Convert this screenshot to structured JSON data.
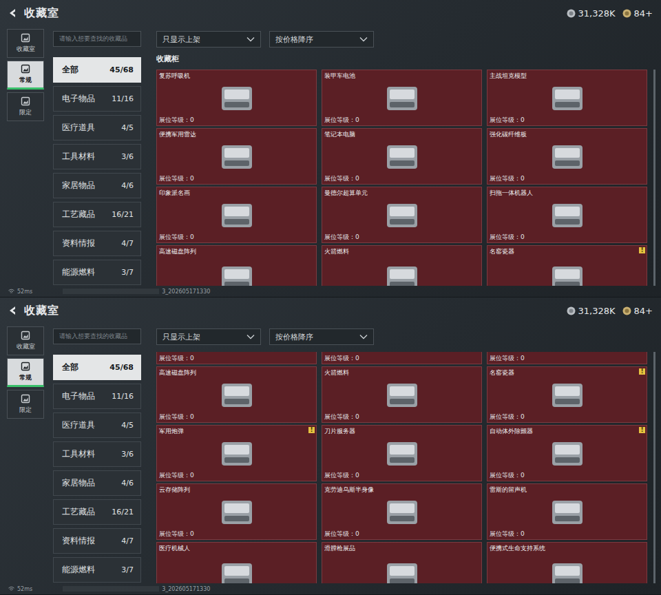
{
  "panels": [
    {
      "header": {
        "title": "收藏室",
        "currencies": [
          {
            "value": "31,328K"
          },
          {
            "value": "84+"
          }
        ]
      },
      "nav": [
        {
          "label": "收藏室",
          "selected": false
        },
        {
          "label": "常规",
          "selected": true
        },
        {
          "label": "限定",
          "selected": false
        }
      ],
      "search": {
        "placeholder": "请输入想要查找的收藏品"
      },
      "categories": [
        {
          "label": "全部",
          "count": "45/68",
          "selected": true
        },
        {
          "label": "电子物品",
          "count": "11/16",
          "selected": false
        },
        {
          "label": "医疗道具",
          "count": "4/5",
          "selected": false
        },
        {
          "label": "工具材料",
          "count": "3/6",
          "selected": false
        },
        {
          "label": "家居物品",
          "count": "4/6",
          "selected": false
        },
        {
          "label": "工艺藏品",
          "count": "16/21",
          "selected": false
        },
        {
          "label": "资料情报",
          "count": "4/7",
          "selected": false
        },
        {
          "label": "能源燃料",
          "count": "3/7",
          "selected": false
        }
      ],
      "filters": [
        "只显示上架",
        "按价格降序"
      ],
      "section_title": "收藏柜",
      "cards": [
        {
          "kind": "full",
          "name": "复苏呼吸机",
          "level": "展位等级：0",
          "badge": ""
        },
        {
          "kind": "full",
          "name": "装甲车电池",
          "level": "展位等级：0",
          "badge": ""
        },
        {
          "kind": "full",
          "name": "主战坦克模型",
          "level": "展位等级：0",
          "badge": ""
        },
        {
          "kind": "full",
          "name": "便携军用雷达",
          "level": "展位等级：0",
          "badge": ""
        },
        {
          "kind": "full",
          "name": "笔记本电脑",
          "level": "展位等级：0",
          "badge": ""
        },
        {
          "kind": "full",
          "name": "强化碳纤维板",
          "level": "展位等级：0",
          "badge": ""
        },
        {
          "kind": "full",
          "name": "印象派名画",
          "level": "展位等级：0",
          "badge": ""
        },
        {
          "kind": "full",
          "name": "曼德尔超算单元",
          "level": "展位等级：0",
          "badge": ""
        },
        {
          "kind": "full",
          "name": "扫拖一体机器人",
          "level": "展位等级：0",
          "badge": ""
        },
        {
          "kind": "top-only",
          "name": "高速磁盘阵列",
          "level": "",
          "badge": ""
        },
        {
          "kind": "top-only",
          "name": "火箭燃料",
          "level": "",
          "badge": ""
        },
        {
          "kind": "top-only",
          "name": "名窑瓷器",
          "level": "",
          "badge": "!"
        }
      ],
      "status": {
        "ping": "52ms",
        "build": "3_202605171330"
      }
    },
    {
      "header": {
        "title": "收藏室",
        "currencies": [
          {
            "value": "31,328K"
          },
          {
            "value": "84+"
          }
        ]
      },
      "nav": [
        {
          "label": "收藏室",
          "selected": false
        },
        {
          "label": "常规",
          "selected": true
        },
        {
          "label": "限定",
          "selected": false
        }
      ],
      "search": {
        "placeholder": "请输入想要查找的收藏品"
      },
      "categories": [
        {
          "label": "全部",
          "count": "45/68",
          "selected": true
        },
        {
          "label": "电子物品",
          "count": "11/16",
          "selected": false
        },
        {
          "label": "医疗道具",
          "count": "4/5",
          "selected": false
        },
        {
          "label": "工具材料",
          "count": "3/6",
          "selected": false
        },
        {
          "label": "家居物品",
          "count": "4/6",
          "selected": false
        },
        {
          "label": "工艺藏品",
          "count": "16/21",
          "selected": false
        },
        {
          "label": "资料情报",
          "count": "4/7",
          "selected": false
        },
        {
          "label": "能源燃料",
          "count": "3/7",
          "selected": false
        }
      ],
      "filters": [
        "只显示上架",
        "按价格降序"
      ],
      "cards": [
        {
          "kind": "level-only",
          "name": "",
          "level": "展位等级：0",
          "badge": ""
        },
        {
          "kind": "level-only",
          "name": "",
          "level": "展位等级：0",
          "badge": ""
        },
        {
          "kind": "level-only",
          "name": "",
          "level": "展位等级：0",
          "badge": ""
        },
        {
          "kind": "full",
          "name": "高速磁盘阵列",
          "level": "展位等级：0",
          "badge": ""
        },
        {
          "kind": "full",
          "name": "火箭燃料",
          "level": "展位等级：0",
          "badge": ""
        },
        {
          "kind": "full",
          "name": "名窑瓷器",
          "level": "展位等级：0",
          "badge": "!"
        },
        {
          "kind": "full",
          "name": "军用炮弹",
          "level": "展位等级：0",
          "badge": "!"
        },
        {
          "kind": "full",
          "name": "刀片服务器",
          "level": "展位等级：0",
          "badge": ""
        },
        {
          "kind": "full",
          "name": "自动体外除颤器",
          "level": "展位等级：0",
          "badge": "!"
        },
        {
          "kind": "full",
          "name": "云存储阵列",
          "level": "展位等级：0",
          "badge": ""
        },
        {
          "kind": "full",
          "name": "克劳迪乌斯半身像",
          "level": "展位等级：0",
          "badge": ""
        },
        {
          "kind": "full",
          "name": "雷斯的留声机",
          "level": "展位等级：0",
          "badge": ""
        },
        {
          "kind": "top-only",
          "name": "医疗机械人",
          "level": "",
          "badge": ""
        },
        {
          "kind": "top-only",
          "name": "滑膛枪展品",
          "level": "",
          "badge": ""
        },
        {
          "kind": "top-only",
          "name": "便携式生命支持系统",
          "level": "",
          "badge": ""
        }
      ],
      "status": {
        "ping": "52ms",
        "build": "3_202605171330"
      }
    }
  ]
}
